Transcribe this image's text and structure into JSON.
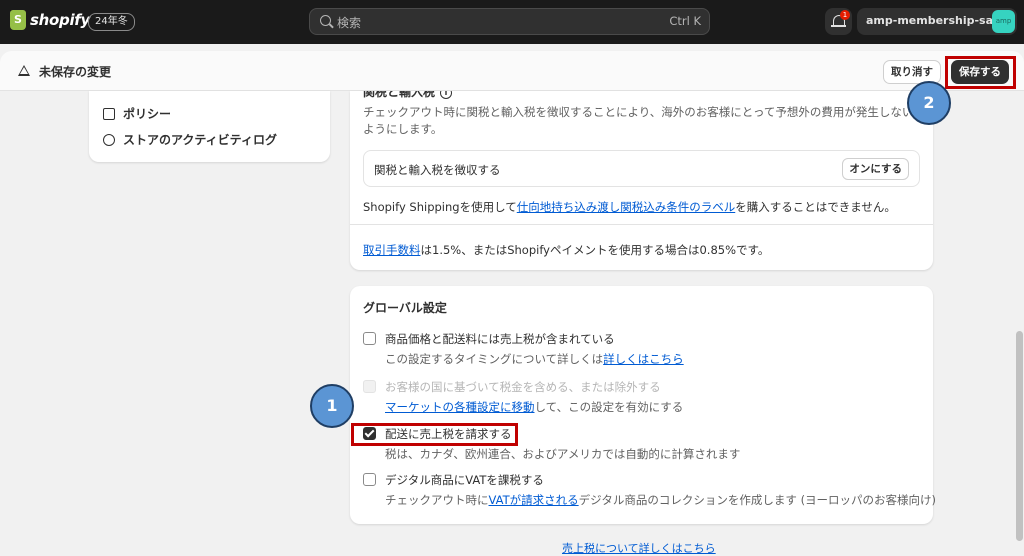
{
  "topbar": {
    "brand": "shopify",
    "version_badge": "24年冬",
    "search_placeholder": "検索",
    "search_shortcut": "Ctrl K",
    "notification_count": "1",
    "store_name": "amp-membership-sa...",
    "store_avatar": "amp"
  },
  "unsaved_bar": {
    "title": "未保存の変更",
    "discard_label": "取り消す",
    "save_label": "保存する"
  },
  "left_nav": {
    "items": [
      {
        "label": "ポリシー",
        "icon": "policy-icon"
      },
      {
        "label": "ストアのアクティビティログ",
        "icon": "activity-log-icon"
      }
    ]
  },
  "duties_card": {
    "heading": "関税と輸入税",
    "description": "チェックアウト時に関税と輸入税を徴収することにより、海外のお客様にとって予想外の費用が発生しないようにします。",
    "duty_toggle_label": "関税と輸入税を徴収する",
    "duty_toggle_button": "オンにする",
    "shipping_prefix": "Shopify Shippingを使用して",
    "shipping_link": "仕向地持ち込み渡し関税込み条件のラベル",
    "shipping_suffix": "を購入することはできません。",
    "fee_link": "取引手数料",
    "fee_text": "は1.5%、またはShopifyペイメントを使用する場合は0.85%です。"
  },
  "global_card": {
    "heading": "グローバル設定",
    "options": [
      {
        "label": "商品価格と配送料には売上税が含まれている",
        "help_prefix": "この設定するタイミングについて詳しくは",
        "help_link": "詳しくはこちら",
        "help_suffix": "",
        "checked": false,
        "disabled": false
      },
      {
        "label": "お客様の国に基づいて税金を含める、または除外する",
        "help_prefix": "",
        "help_link": "マーケットの各種設定に移動",
        "help_suffix": "して、この設定を有効にする",
        "checked": false,
        "disabled": true
      },
      {
        "label": "配送に売上税を請求する",
        "help_prefix": "税は、カナダ、欧州連合、およびアメリカでは自動的に計算されます",
        "help_link": "",
        "help_suffix": "",
        "checked": true,
        "disabled": false
      },
      {
        "label": "デジタル商品にVATを課税する",
        "help_prefix": "チェックアウト時に",
        "help_link": "VATが請求される",
        "help_suffix": "デジタル商品のコレクションを作成します (ヨーロッパのお客様向け)",
        "checked": false,
        "disabled": false
      }
    ]
  },
  "bottom_link": "売上税について詳しくはこちら",
  "annotations": {
    "step1": "1",
    "step2": "2",
    "highlight_color": "#c00000",
    "step_color": "#5b95d4"
  }
}
